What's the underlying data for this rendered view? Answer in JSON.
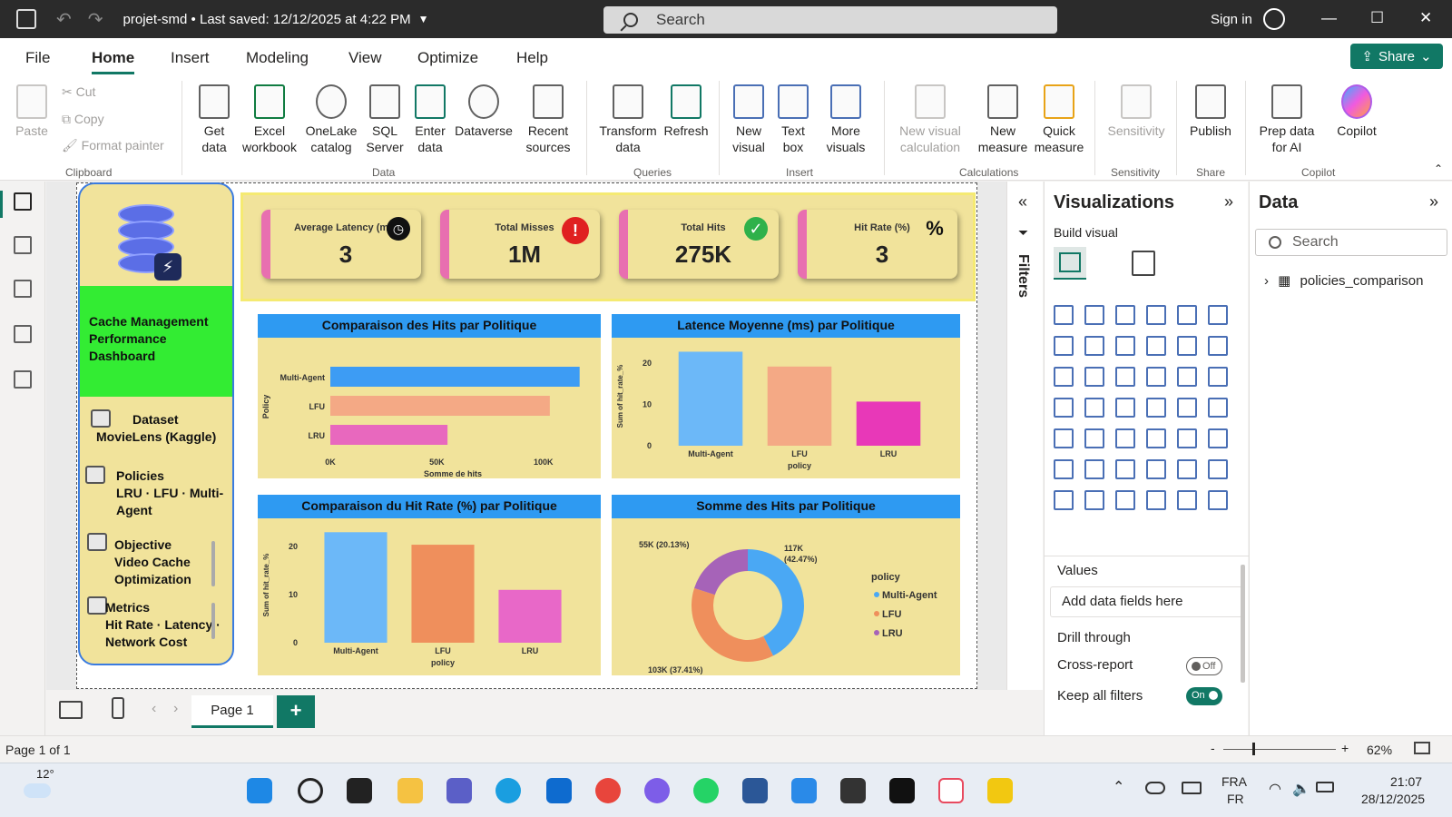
{
  "titlebar": {
    "doc_title": "projet-smd • Last saved: 12/12/2025 at 4:22 PM",
    "search_placeholder": "Search",
    "signin": "Sign in"
  },
  "menu": {
    "tabs": [
      "File",
      "Home",
      "Insert",
      "Modeling",
      "View",
      "Optimize",
      "Help"
    ],
    "active": "Home",
    "share_label": "Share"
  },
  "ribbon": {
    "clipboard": {
      "paste": "Paste",
      "cut": "Cut",
      "copy": "Copy",
      "format_painter": "Format painter",
      "label": "Clipboard"
    },
    "data": {
      "label": "Data",
      "get_data": "Get data",
      "excel": "Excel workbook",
      "onelake": "OneLake catalog",
      "sql": "SQL Server",
      "enter": "Enter data",
      "dataverse": "Dataverse",
      "recent": "Recent sources"
    },
    "queries": {
      "label": "Queries",
      "transform": "Transform data",
      "refresh": "Refresh"
    },
    "insert": {
      "label": "Insert",
      "new_visual": "New visual",
      "text_box": "Text box",
      "more_visuals": "More visuals"
    },
    "calculations": {
      "label": "Calculations",
      "new_visual_calc": "New visual calculation",
      "new_measure": "New measure",
      "quick_measure": "Quick measure"
    },
    "sensitivity": {
      "label": "Sensitivity",
      "btn": "Sensitivity"
    },
    "share": {
      "label": "Share",
      "publish": "Publish"
    },
    "copilot": {
      "label": "Copilot",
      "prep": "Prep data for AI",
      "copilot": "Copilot"
    }
  },
  "left_panel": {
    "title": "Cache Management Performance Dashboard",
    "dataset_label": "Dataset",
    "dataset_value": "MovieLens (Kaggle)",
    "policies_label": "Policies",
    "policies_value": "LRU · LFU · Multi-Agent",
    "objective_label": "Objective",
    "objective_value": "Video Cache Optimization",
    "metrics_label": "Metrics",
    "metrics_value": "Hit Rate · Latency · Network Cost"
  },
  "kpis": [
    {
      "label": "Average Latency (ms)",
      "value": "3",
      "icon": "stopwatch-icon",
      "color": "#111111",
      "symbol": "◷"
    },
    {
      "label": "Total Misses",
      "value": "1M",
      "icon": "alert-icon",
      "color": "#e02020",
      "symbol": "!"
    },
    {
      "label": "Total Hits",
      "value": "275K",
      "icon": "check-icon",
      "color": "#2fb14a",
      "symbol": "✓"
    },
    {
      "label": "Hit Rate (%)",
      "value": "3",
      "icon": "percent-icon",
      "color": "#f1e39b",
      "symbol": "%"
    }
  ],
  "chart_data": [
    {
      "type": "bar",
      "orientation": "horizontal",
      "title": "Comparaison des Hits par Politique",
      "ylabel": "Policy",
      "xlabel": "Somme de hits",
      "categories": [
        "Multi-Agent",
        "LFU",
        "LRU"
      ],
      "values": [
        117000,
        103000,
        55000
      ],
      "xlim": [
        0,
        115000
      ],
      "ticks": [
        0,
        50000,
        100000
      ],
      "tick_labels": [
        "0K",
        "50K",
        "100K"
      ],
      "colors": [
        "#3d9cf4",
        "#f4a985",
        "#e868be"
      ]
    },
    {
      "type": "bar",
      "title": "Latence Moyenne (ms) par Politique",
      "ylabel": "Sum of hit_rate_%",
      "xlabel": "policy",
      "categories": [
        "Multi-Agent",
        "LFU",
        "LRU"
      ],
      "values": [
        22.8,
        19.2,
        10.7
      ],
      "ylim": [
        0,
        24
      ],
      "ticks": [
        0,
        10,
        20
      ],
      "colors": [
        "#6cb8f8",
        "#f4a985",
        "#e838b8"
      ]
    },
    {
      "type": "bar",
      "title": "Comparaison du Hit Rate (%) par Politique",
      "ylabel": "Sum of hit_rate_%",
      "xlabel": "policy",
      "categories": [
        "Multi-Agent",
        "LFU",
        "LRU"
      ],
      "values": [
        23.0,
        20.4,
        11.0
      ],
      "ylim": [
        0,
        24
      ],
      "ticks": [
        0,
        10,
        20
      ],
      "colors": [
        "#6cb8f8",
        "#ef8f5c",
        "#e868c8"
      ]
    },
    {
      "type": "pie",
      "donut": true,
      "title": "Somme des Hits par Politique",
      "legend_title": "policy",
      "legend_position": "right",
      "categories": [
        "Multi-Agent",
        "LFU",
        "LRU"
      ],
      "values": [
        117000,
        103000,
        55000
      ],
      "labels": [
        "117K (42.47%)",
        "103K (37.41%)",
        "55K (20.13%)"
      ],
      "colors": [
        "#4aa8f4",
        "#ef8f5c",
        "#a663b8"
      ]
    }
  ],
  "filters": {
    "label": "Filters"
  },
  "viz_pane": {
    "title": "Visualizations",
    "build_visual": "Build visual",
    "values": "Values",
    "add_fields": "Add data fields here",
    "drill_through": "Drill through",
    "cross_report": "Cross-report",
    "cross_report_state": "Off",
    "keep_filters": "Keep all filters",
    "keep_filters_state": "On"
  },
  "data_pane": {
    "title": "Data",
    "search_placeholder": "Search",
    "table": "policies_comparison"
  },
  "pages": {
    "current": "Page 1",
    "add": "+"
  },
  "status": {
    "page": "Page 1 of 1",
    "zoom": "62%"
  },
  "taskbar": {
    "weather": "12°",
    "lang1": "FRA",
    "lang2": "FR",
    "time": "21:07",
    "date": "28/12/2025"
  }
}
